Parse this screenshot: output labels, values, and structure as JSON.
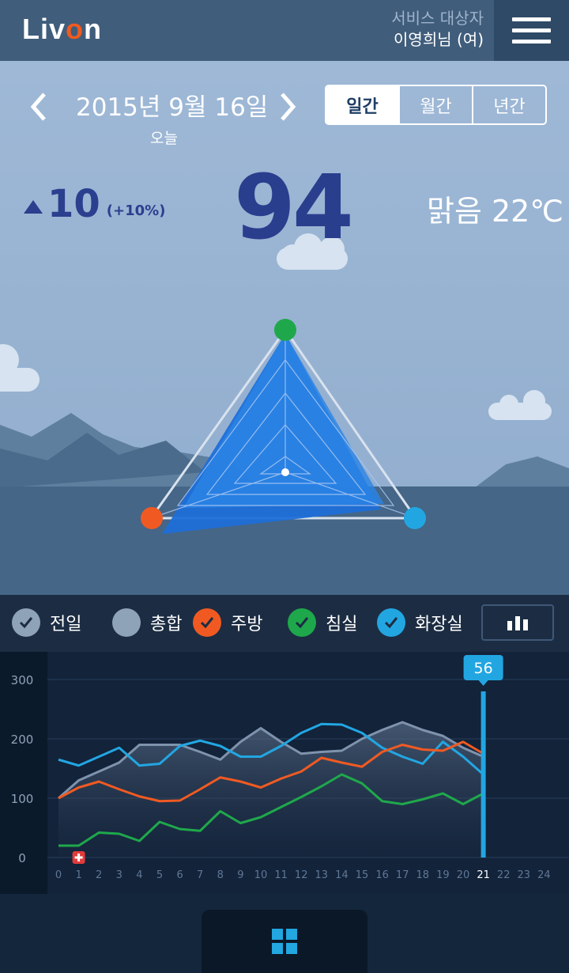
{
  "header": {
    "logo_prefix": "Liv",
    "logo_o": "o",
    "logo_suffix": "n",
    "user_role": "서비스 대상자",
    "user_name": "이영희님 (여)"
  },
  "date_nav": {
    "date": "2015년 9월 16일",
    "today": "오늘"
  },
  "period_tabs": [
    "일간",
    "월간",
    "년간"
  ],
  "summary": {
    "delta_value": "10",
    "delta_pct": "(+10%)",
    "score": "94",
    "weather": "맑음 22℃"
  },
  "legend": [
    {
      "label": "전일",
      "checked": true,
      "color": "#8ea2b8"
    },
    {
      "label": "총합",
      "checked": false,
      "color": "#8ea2b8"
    },
    {
      "label": "주방",
      "checked": true,
      "color": "#f05a22"
    },
    {
      "label": "침실",
      "checked": true,
      "color": "#1fa84b"
    },
    {
      "label": "화장실",
      "checked": true,
      "color": "#22a6e2"
    }
  ],
  "icons": {
    "prev": "chevron-left-icon",
    "next": "chevron-right-icon",
    "menu": "hamburger-menu-icon",
    "chart_toggle": "bar-chart-icon",
    "home": "grid-icon",
    "alert": "medical-cross-icon"
  },
  "chart_data": {
    "type": "line",
    "x": [
      0,
      1,
      2,
      3,
      4,
      5,
      6,
      7,
      8,
      9,
      10,
      11,
      12,
      13,
      14,
      15,
      16,
      17,
      18,
      19,
      20,
      21,
      22,
      23,
      24
    ],
    "y_ticks": [
      0,
      100,
      200,
      300
    ],
    "ylim": [
      0,
      300
    ],
    "xlim": [
      0,
      24
    ],
    "selected_x": 21,
    "selected_value": "56",
    "alert_x": 1,
    "series": [
      {
        "name": "총합",
        "color": "#7f93ad",
        "x": [
          0,
          1,
          2,
          3,
          4,
          5,
          6,
          7,
          8,
          9,
          10,
          11,
          12,
          13,
          14,
          15,
          16,
          17,
          18,
          19,
          20,
          21
        ],
        "values": [
          100,
          130,
          145,
          160,
          190,
          190,
          190,
          178,
          165,
          195,
          218,
          195,
          175,
          178,
          180,
          200,
          215,
          228,
          215,
          205,
          185,
          170
        ]
      },
      {
        "name": "화장실",
        "color": "#22a6e2",
        "x": [
          0,
          1,
          2,
          3,
          4,
          5,
          6,
          7,
          8,
          9,
          10,
          11,
          12,
          13,
          14,
          15,
          16,
          17,
          18,
          19,
          20,
          21
        ],
        "values": [
          165,
          155,
          170,
          185,
          155,
          158,
          188,
          197,
          188,
          170,
          170,
          188,
          210,
          225,
          224,
          210,
          185,
          170,
          158,
          195,
          170,
          140
        ]
      },
      {
        "name": "주방",
        "color": "#f05a22",
        "x": [
          0,
          1,
          2,
          3,
          4,
          5,
          6,
          7,
          8,
          9,
          10,
          11,
          12,
          13,
          14,
          15,
          16,
          17,
          18,
          19,
          20,
          21
        ],
        "values": [
          100,
          118,
          128,
          115,
          103,
          95,
          96,
          115,
          135,
          128,
          118,
          133,
          145,
          168,
          160,
          153,
          178,
          190,
          182,
          180,
          195,
          175
        ]
      },
      {
        "name": "침실",
        "color": "#1fa84b",
        "x": [
          0,
          1,
          2,
          3,
          4,
          5,
          6,
          7,
          8,
          9,
          10,
          11,
          12,
          13,
          14,
          15,
          16,
          17,
          18,
          19,
          20,
          21
        ],
        "values": [
          20,
          20,
          42,
          40,
          28,
          60,
          48,
          45,
          78,
          58,
          68,
          85,
          102,
          120,
          140,
          125,
          95,
          90,
          98,
          108,
          90,
          108
        ]
      }
    ]
  }
}
